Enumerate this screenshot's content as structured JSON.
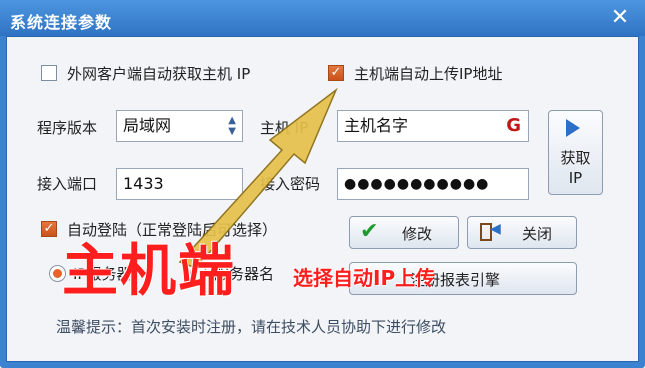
{
  "window": {
    "title": "系统连接参数",
    "close_glyph": "✕"
  },
  "options": {
    "wan_auto_ip": {
      "label": "外网客户端自动获取主机 IP",
      "checked": false
    },
    "host_upload_ip": {
      "label": "主机端自动上传IP地址",
      "checked": true
    }
  },
  "form": {
    "version_label": "程序版本",
    "version_value": "局域网",
    "host_ip_label": "主机 IP",
    "host_ip_value": "主机名字",
    "port_label": "接入端口",
    "port_value": "1433",
    "password_label": "接入密码",
    "password_value": "●●●●●●●●●●●"
  },
  "get_ip_button": {
    "label_line1": "获取",
    "label_line2": "IP"
  },
  "auto_login": {
    "label": "自动登陆（正常登陆后可选择）",
    "checked": true
  },
  "buttons": {
    "modify": "修改",
    "close": "关闭",
    "report_engine": "注册报表引擎"
  },
  "server_mode": {
    "option1": "IP服务器",
    "option2": "服务器名",
    "selected": "option1"
  },
  "hint": "温馨提示：首次安装时注册，请在技术人员协助下进行修改",
  "overlay": {
    "big_text": "主机端",
    "small_text": "选择自动IP上传"
  },
  "colors": {
    "title_bar": "#2f74c4",
    "accent_orange": "#e8622a",
    "overlay_red": "#ff1e1e"
  },
  "icons": {
    "refresh": "refresh-icon",
    "get_ip": "arrow-right-icon",
    "modify": "checkmark-icon",
    "close": "exit-door-icon"
  }
}
